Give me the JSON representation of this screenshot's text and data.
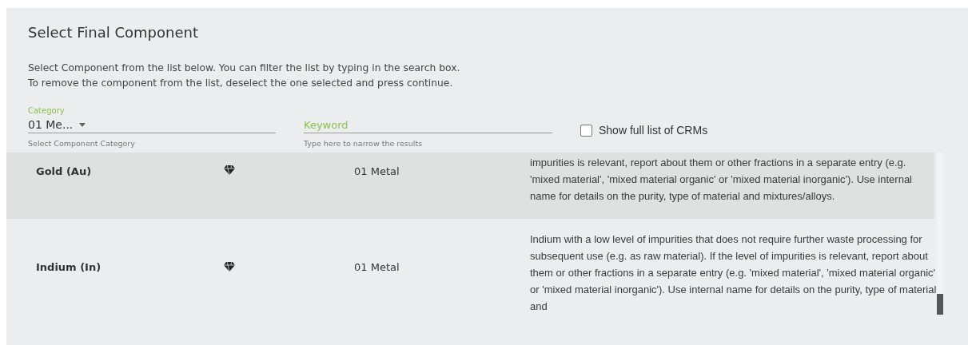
{
  "title": "Select Final Component",
  "instructions": [
    "Select Component from the list below. You can filter the list by typing in the search box.",
    "To remove the component from the list, deselect the one selected and press continue."
  ],
  "category": {
    "label": "Category",
    "value": "01 Me...",
    "helper": "Select Component Category"
  },
  "keyword": {
    "placeholder": "Keyword",
    "helper": "Type here to narrow the results"
  },
  "show_full_list": {
    "label": "Show full list of CRMs",
    "checked": false
  },
  "rows": [
    {
      "name": "Gold (Au)",
      "category": "01 Metal",
      "description": "impurities is relevant, report about them or other fractions in a separate entry (e.g. 'mixed material', 'mixed material organic' or 'mixed material inorganic'). Use internal name for details on the purity, type of material and mixtures/alloys.",
      "selected": true
    },
    {
      "name": "Indium (In)",
      "category": "01 Metal",
      "description": "Indium with a low level of impurities that does not require further waste processing for subsequent use (e.g. as raw material). If the level of impurities is relevant, report about them or other fractions in a separate entry (e.g. 'mixed material', 'mixed material organic' or 'mixed material inorganic'). Use internal name for details on the purity, type of material and",
      "selected": false
    }
  ]
}
